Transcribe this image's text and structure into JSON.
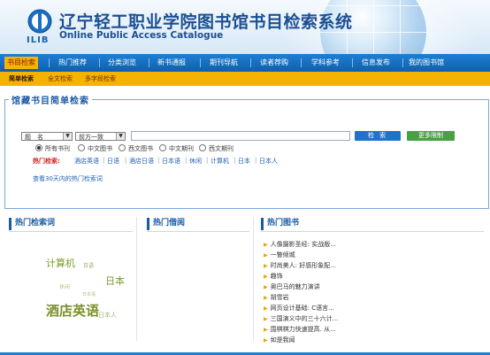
{
  "header": {
    "logo_caption": "ILIB",
    "title_cn": "辽宁轻工职业学院图书馆书目检索系统",
    "title_en": "Online Public Access Catalogue"
  },
  "nav": {
    "items": [
      {
        "label": "书目检索",
        "active": true
      },
      {
        "label": "热门推荐"
      },
      {
        "label": "分类浏览"
      },
      {
        "label": "新书通报"
      },
      {
        "label": "期刊导航"
      },
      {
        "label": "读者荐购"
      },
      {
        "label": "学科参考"
      },
      {
        "label": "信息发布"
      },
      {
        "label": "我的图书馆"
      }
    ]
  },
  "subnav": {
    "items": [
      {
        "label": "简单检索",
        "active": true
      },
      {
        "label": "全文检索"
      },
      {
        "label": "多字段检索"
      }
    ]
  },
  "search": {
    "panel_title": "馆藏书目简单检索",
    "field_select": "题　名",
    "match_select": "前方一致",
    "query_value": "",
    "search_button": "检 索",
    "more_button": "更多限制",
    "doc_types": [
      {
        "label": "所有书刊",
        "checked": true
      },
      {
        "label": "中文图书",
        "checked": false
      },
      {
        "label": "西文图书",
        "checked": false
      },
      {
        "label": "中文期刊",
        "checked": false
      },
      {
        "label": "西文期刊",
        "checked": false
      }
    ],
    "hot_label": "热门检索:",
    "hot_terms": [
      "酒店英语",
      "日语",
      "酒店日语",
      "日本语",
      "休闲",
      "计算机",
      "日本",
      "日本人"
    ],
    "hot_30_link": "查看30天内的热门检索词"
  },
  "columns": {
    "hot_words_title": "热门检索词",
    "hot_borrow_title": "热门借阅",
    "hot_books_title": "热门图书"
  },
  "word_cloud": [
    {
      "text": "计算机",
      "color": "#7a9a2e"
    },
    {
      "text": "日语",
      "color": "#8faa5c"
    },
    {
      "text": "休闲",
      "color": "#b0c48a"
    },
    {
      "text": "日本",
      "color": "#7a9a2e"
    },
    {
      "text": "日本语",
      "color": "#b0c48a"
    },
    {
      "text": "酒店英语",
      "color": "#7a8f2a"
    },
    {
      "text": "日本人",
      "color": "#a0b47a"
    }
  ],
  "hot_books": [
    "人像摄影圣经: 实战版...",
    "一瞥倾城",
    "时尚美人: 好感形象配...",
    "趣饰",
    "奥巴马的魅力演讲",
    "胡雪岩",
    "网页设计基础: C语言...",
    "三国演义中的三十六计...",
    "围棋棋力快速提高. 从...",
    "如是我闻"
  ]
}
